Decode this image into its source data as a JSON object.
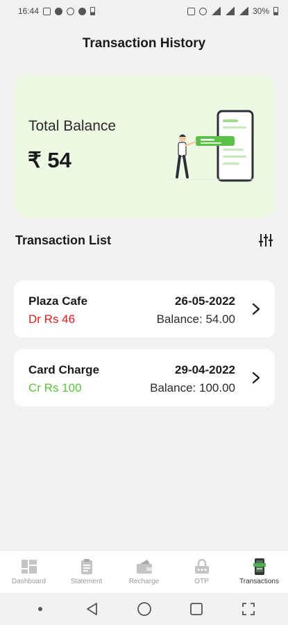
{
  "status_bar": {
    "time": "16:44",
    "battery": "30%"
  },
  "header": {
    "title": "Transaction History"
  },
  "balance_card": {
    "label": "Total Balance",
    "amount": "₹ 54"
  },
  "transaction_list": {
    "title": "Transaction List",
    "items": [
      {
        "name": "Plaza Cafe",
        "amount": "Dr Rs 46",
        "type": "debit",
        "date": "26-05-2022",
        "balance": "Balance: 54.00"
      },
      {
        "name": "Card Charge",
        "amount": "Cr Rs 100",
        "type": "credit",
        "date": "29-04-2022",
        "balance": "Balance: 100.00"
      }
    ]
  },
  "bottom_nav": {
    "items": [
      {
        "label": "Dashboard",
        "icon": "dashboard-icon"
      },
      {
        "label": "Statement",
        "icon": "statement-icon"
      },
      {
        "label": "Recharge",
        "icon": "recharge-icon"
      },
      {
        "label": "OTP",
        "icon": "otp-icon"
      },
      {
        "label": "Transactions",
        "icon": "transactions-icon",
        "active": true
      }
    ]
  },
  "colors": {
    "card_bg": "#eef9e3",
    "debit": "#e21b1b",
    "credit": "#57c43a",
    "accent": "#4caf50"
  }
}
